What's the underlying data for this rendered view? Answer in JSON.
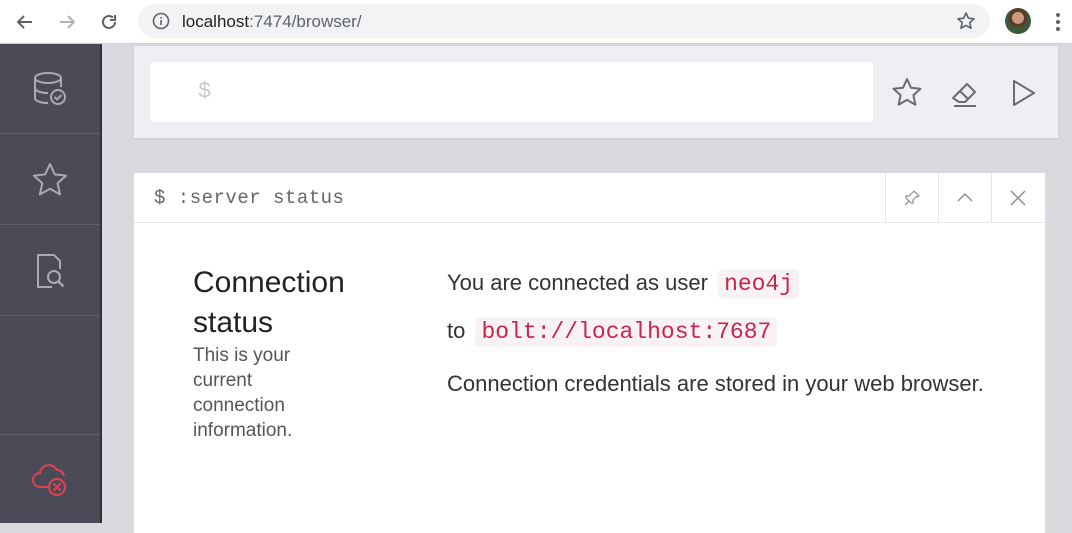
{
  "browser": {
    "url_host": "localhost",
    "url_rest": ":7474/browser/"
  },
  "sidebar": {
    "items": [
      {
        "icon": "database-check-icon"
      },
      {
        "icon": "star-icon"
      },
      {
        "icon": "document-search-icon"
      }
    ],
    "bottom": {
      "icon": "cloud-disconnected-icon",
      "color": "#e3404f"
    }
  },
  "editor": {
    "prompt": "$"
  },
  "frame": {
    "command": "$ :server status",
    "title": "Connection status",
    "subtitle": "This is your current connection information.",
    "line1_text": "You are connected as user",
    "user": "neo4j",
    "line2_text": "to",
    "bolt_url": "bolt://localhost:7687",
    "line3_text": "Connection credentials are stored in your web browser."
  },
  "colors": {
    "sidebar_bg": "#4a4b57",
    "code_text": "#c7254e",
    "code_bg": "#f9f2f4",
    "disconnect_red": "#e3404f"
  }
}
